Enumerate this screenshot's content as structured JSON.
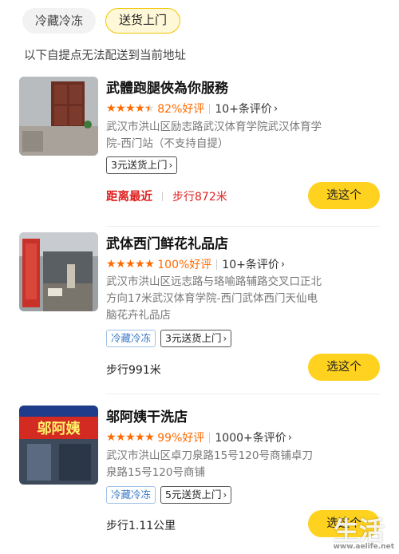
{
  "tabs": [
    {
      "label": "冷藏冷冻",
      "active": false
    },
    {
      "label": "送货上门",
      "active": true
    }
  ],
  "notice": "以下自提点无法配送到当前地址",
  "stores": [
    {
      "name": "武體跑腿俠為你服務",
      "rating_stars": 4.5,
      "rating_pct": "82%好评",
      "reviews": "10+条评价",
      "address": "武汉市洪山区励志路武汉体育学院武汉体育学院-西门站（不支持自提）",
      "tags": [],
      "delivery_tag": "3元送货上门",
      "nearest": "距离最近",
      "walk": "步行872米",
      "button": "选这个"
    },
    {
      "name": "武体西门鲜花礼品店",
      "rating_stars": 5,
      "rating_pct": "100%好评",
      "reviews": "10+条评价",
      "address": "武汉市洪山区远志路与珞喻路辅路交叉口正北方向17米武汉体育学院-西门武体西门天仙电脑花卉礼品店",
      "tags": [
        "冷藏冷冻"
      ],
      "delivery_tag": "3元送货上门",
      "walk": "步行991米",
      "button": "选这个"
    },
    {
      "name": "邬阿姨干洗店",
      "rating_stars": 5,
      "rating_pct": "99%好评",
      "reviews": "1000+条评价",
      "address": "武汉市洪山区卓刀泉路15号120号商铺卓刀泉路15号120号商铺",
      "tags": [
        "冷藏冷冻"
      ],
      "delivery_tag": "5元送货上门",
      "walk": "步行1.11公里",
      "button": "选这个"
    }
  ],
  "sign_text": "邬阿姨",
  "watermark": "生活",
  "watermark_url": "www.aelife.net",
  "icons": {
    "chevron": "chevron-right-icon",
    "star": "star-icon"
  },
  "colors": {
    "accent": "#ffd21f",
    "rating": "#ff6a00",
    "nearest": "#e02020",
    "cold_tag": "#3a78c6"
  }
}
